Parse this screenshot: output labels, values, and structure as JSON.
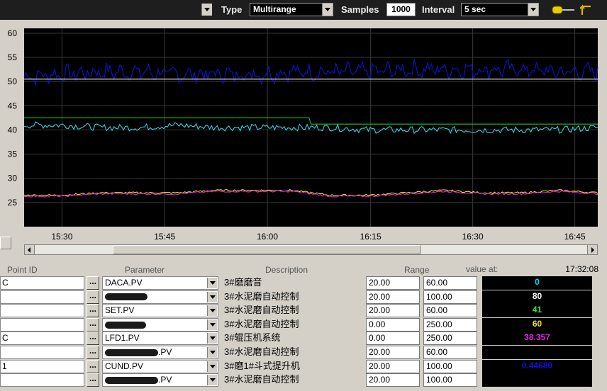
{
  "toolbar": {
    "type_label": "Type",
    "type_value": "Multirange",
    "samples_label": "Samples",
    "samples_value": "1000",
    "interval_label": "Interval",
    "interval_value": "5 sec"
  },
  "chart_data": {
    "type": "line",
    "ylim": [
      20,
      61
    ],
    "yticks": [
      25,
      30,
      35,
      40,
      45,
      50,
      55,
      60
    ],
    "xticks": [
      "15:30",
      "15:45",
      "16:00",
      "16:15",
      "16:30",
      "16:45"
    ],
    "grid": true,
    "background": "#000000",
    "series": [
      {
        "color": "#1010d0",
        "approx_values": [
          51,
          51.5,
          52,
          52,
          51.5,
          51.5,
          51.5,
          52,
          52,
          52,
          52.5,
          52.5,
          52.5,
          52.5,
          52,
          52
        ]
      },
      {
        "color": "#ffffff",
        "approx_values": [
          50.5,
          50.5,
          50.5,
          50.5,
          50.5,
          50.5,
          50.5,
          50.5,
          50.5,
          50.5,
          50.5,
          50.5,
          50.5,
          50.5,
          50.5,
          50.5
        ]
      },
      {
        "color": "#20c020",
        "approx_values": [
          42.5,
          42.5,
          42.5,
          42.5,
          42.5,
          42.5,
          42.5,
          42.5,
          41.2,
          41.2,
          41.2,
          41.2,
          41.2,
          41.2,
          41.2,
          41.2
        ]
      },
      {
        "color": "#30d0e0",
        "approx_values": [
          41,
          41,
          40.5,
          40.5,
          41,
          40.5,
          40.5,
          40.5,
          40.5,
          40,
          40,
          40,
          40,
          40,
          40,
          40.5
        ]
      },
      {
        "color": "#f0e020",
        "approx_values": [
          26.5,
          26.5,
          27,
          27,
          27,
          27.5,
          27.5,
          27.5,
          26.5,
          26.5,
          27,
          27.5,
          27,
          27,
          27.5,
          27
        ]
      },
      {
        "color": "#e020e0",
        "approx_values": [
          26.3,
          26.3,
          26.8,
          26.8,
          26.8,
          27.3,
          27.3,
          27.3,
          26.3,
          26.3,
          26.8,
          27.3,
          26.8,
          26.8,
          27.3,
          26.8
        ]
      }
    ]
  },
  "table": {
    "headers": {
      "point_id": "Point ID",
      "parameter": "Parameter",
      "description": "Description",
      "range": "Range",
      "value_at": "value at:"
    },
    "value_at_time": "17:32:08",
    "ellipsis": "...",
    "rows": [
      {
        "point_id": "C",
        "parameter": "DACA.PV",
        "description": "3#磨磨音",
        "range_min": "20.00",
        "range_max": "60.00",
        "value": "0",
        "value_color": "#00e0ff"
      },
      {
        "point_id": "",
        "parameter": "",
        "description": "3#水泥磨自动控制",
        "range_min": "20.00",
        "range_max": "100.00",
        "value": "80",
        "value_color": "#ffffff"
      },
      {
        "point_id": "",
        "parameter": "SET.PV",
        "description": "3#水泥磨自动控制",
        "range_min": "20.00",
        "range_max": "60.00",
        "value": "41",
        "value_color": "#40e040"
      },
      {
        "point_id": "",
        "parameter": "",
        "description": "3#水泥磨自动控制",
        "range_min": "0.00",
        "range_max": "250.00",
        "value": "60",
        "value_color": "#f0e020"
      },
      {
        "point_id": "C",
        "parameter": "LFD1.PV",
        "description": "3#辊压机系统",
        "range_min": "0.00",
        "range_max": "250.00",
        "value": "38.357",
        "value_color": "#e020e0"
      },
      {
        "point_id": "",
        "parameter": ".PV",
        "description": "3#水泥磨自动控制",
        "range_min": "20.00",
        "range_max": "60.00",
        "value": "",
        "value_color": "#ffffff"
      },
      {
        "point_id": "1",
        "parameter": "CUND.PV",
        "description": "3#磨1#斗式提升机",
        "range_min": "20.00",
        "range_max": "100.00",
        "value": "0.44680",
        "value_color": "#1010e0"
      },
      {
        "point_id": "",
        "parameter": ".PV",
        "description": "3#水泥磨自动控制",
        "range_min": "20.00",
        "range_max": "100.00",
        "value": "",
        "value_color": "#ffffff"
      }
    ]
  }
}
